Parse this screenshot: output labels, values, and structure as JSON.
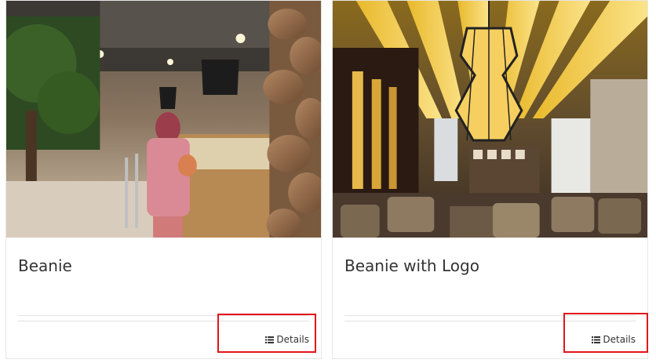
{
  "cards": [
    {
      "title": "Beanie",
      "details_label": "Details",
      "image_icon": "bakery-photo"
    },
    {
      "title": "Beanie with Logo",
      "details_label": "Details",
      "image_icon": "restaurant-photo"
    }
  ],
  "icons": {
    "details": "list-icon"
  },
  "colors": {
    "highlight": "#e3141a",
    "text": "#333333",
    "border": "#e6e6e6"
  }
}
